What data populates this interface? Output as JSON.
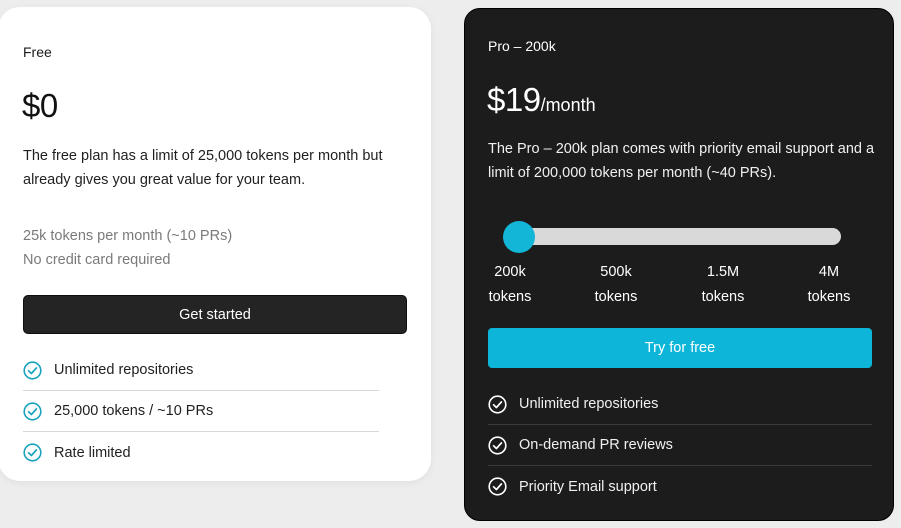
{
  "free_plan": {
    "name": "Free",
    "price": "$0",
    "description": "The free plan has a limit of 25,000 tokens per month but already gives you great value for your team.",
    "meta": [
      "25k tokens per month (~10 PRs)",
      "No credit card required"
    ],
    "cta_label": "Get started",
    "features": [
      "Unlimited repositories",
      "25,000 tokens / ~10 PRs",
      "Rate limited"
    ]
  },
  "pro_plan": {
    "name": "Pro – 200k",
    "price_amount": "$19",
    "price_period": "/month",
    "description": "The Pro – 200k plan comes with priority email support and a limit of 200,000 tokens per month (~40 PRs).",
    "slider": {
      "selected_index": 0,
      "options": [
        {
          "value": "200k",
          "unit": "tokens"
        },
        {
          "value": "500k",
          "unit": "tokens"
        },
        {
          "value": "1.5M",
          "unit": "tokens"
        },
        {
          "value": "4M",
          "unit": "tokens"
        }
      ]
    },
    "cta_label": "Try for free",
    "features": [
      "Unlimited repositories",
      "On-demand PR reviews",
      "Priority Email support"
    ]
  },
  "colors": {
    "accent": "#0db6d8",
    "free_check": "#1aa3bd",
    "dark_card": "#1c1c1c"
  },
  "icons": {
    "feature_check": "check-circle-icon"
  }
}
